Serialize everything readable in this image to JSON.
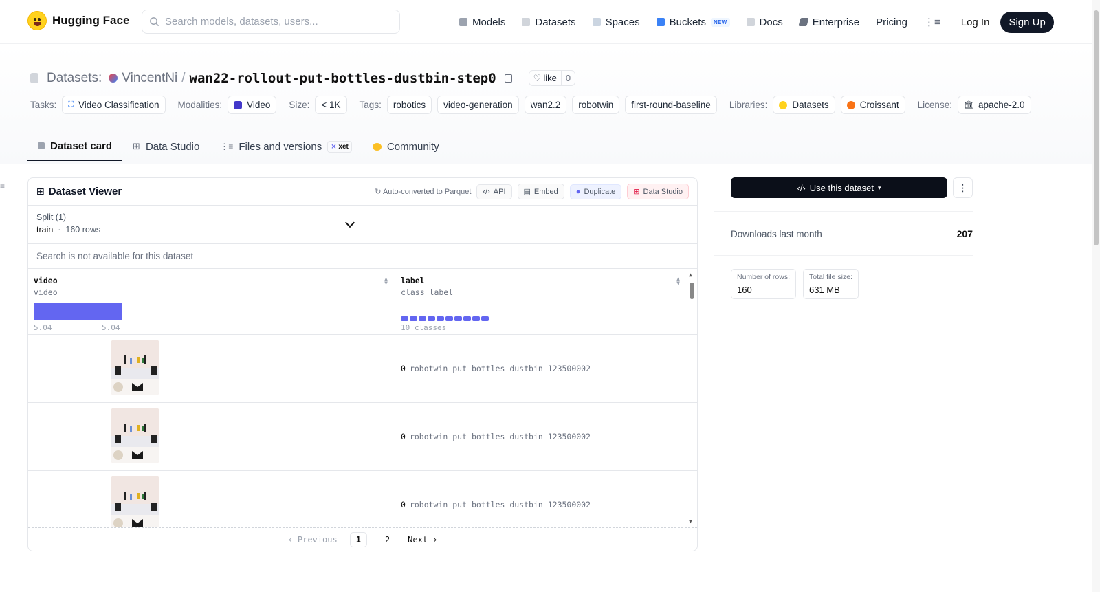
{
  "brand": {
    "name": "Hugging Face"
  },
  "search": {
    "placeholder": "Search models, datasets, users..."
  },
  "nav": {
    "items": [
      {
        "label": "Models",
        "icon": "cube-icon",
        "color": "#9ca3af"
      },
      {
        "label": "Datasets",
        "icon": "database-icon",
        "color": "#d1d5db"
      },
      {
        "label": "Spaces",
        "icon": "grid-icon",
        "color": "#cbd5e1"
      },
      {
        "label": "Buckets",
        "icon": "bucket-icon",
        "color": "#3b82f6",
        "badge": "NEW"
      },
      {
        "label": "Docs",
        "icon": "book-icon",
        "color": "#d1d5db"
      },
      {
        "label": "Enterprise",
        "icon": "enterprise-icon",
        "color": "#6b7280"
      },
      {
        "label": "Pricing"
      }
    ],
    "login": "Log In",
    "signup": "Sign Up"
  },
  "repo": {
    "section": "Datasets:",
    "owner": "VincentNi",
    "name": "wan22-rollout-put-bottles-dustbin-step0",
    "like_label": "like",
    "like_count": "0"
  },
  "meta": {
    "tasks_label": "Tasks:",
    "task": "Video Classification",
    "modalities_label": "Modalities:",
    "modality": "Video",
    "size_label": "Size:",
    "size": "< 1K",
    "tags_label": "Tags:",
    "tags": [
      "robotics",
      "video-generation",
      "wan2.2",
      "robotwin",
      "first-round-baseline"
    ],
    "libraries_label": "Libraries:",
    "libraries": [
      "Datasets",
      "Croissant"
    ],
    "license_label": "License:",
    "license": "apache-2.0"
  },
  "tabs": [
    {
      "label": "Dataset card",
      "active": true
    },
    {
      "label": "Data Studio"
    },
    {
      "label": "Files and versions",
      "badge": "xet"
    },
    {
      "label": "Community"
    }
  ],
  "viewer": {
    "title": "Dataset Viewer",
    "auto_link": "Auto-converted",
    "auto_suffix": "to Parquet",
    "actions": [
      "API",
      "Embed",
      "Duplicate",
      "Data Studio"
    ],
    "split_label": "Split (1)",
    "split_name": "train",
    "split_rows": "160 rows",
    "search_na": "Search is not available for this dataset",
    "columns": [
      {
        "name": "video",
        "type": "video",
        "min": "5.04",
        "max": "5.04"
      },
      {
        "name": "label",
        "type": "class label",
        "summary": "10 classes"
      }
    ],
    "rows": [
      {
        "label_id": "0",
        "label_name": "robotwin_put_bottles_dustbin_123500002"
      },
      {
        "label_id": "0",
        "label_name": "robotwin_put_bottles_dustbin_123500002"
      },
      {
        "label_id": "0",
        "label_name": "robotwin_put_bottles_dustbin_123500002"
      }
    ],
    "pager": {
      "prev": "Previous",
      "pages": [
        "1",
        "2"
      ],
      "current": "1",
      "next": "Next"
    }
  },
  "sidebar": {
    "use_button": "Use this dataset",
    "downloads_label": "Downloads last month",
    "downloads_value": "207",
    "rows_label": "Number of rows:",
    "rows_value": "160",
    "size_label": "Total file size:",
    "size_value": "631 MB"
  },
  "colors": {
    "accent": "#6366f1",
    "dark": "#111827"
  }
}
